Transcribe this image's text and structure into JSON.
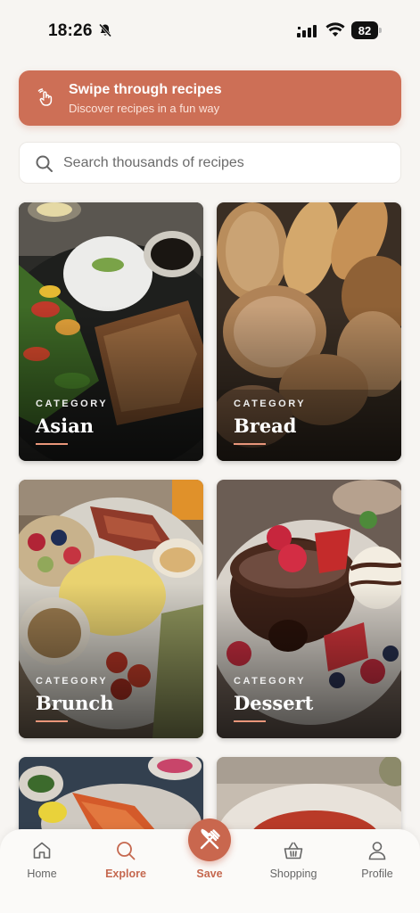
{
  "status_bar": {
    "time": "18:26",
    "battery": "82",
    "icons": [
      "bell-slash-icon",
      "signal-icon",
      "wifi-icon",
      "battery-icon"
    ]
  },
  "banner": {
    "title": "Swipe through recipes",
    "subtitle": "Discover recipes in a fun way",
    "icon": "swipe-hand-icon",
    "color": "#cd6f56"
  },
  "search": {
    "placeholder": "Search thousands of recipes",
    "value": ""
  },
  "categories": [
    {
      "label": "CATEGORY",
      "name": "Asian"
    },
    {
      "label": "CATEGORY",
      "name": "Bread"
    },
    {
      "label": "CATEGORY",
      "name": "Brunch"
    },
    {
      "label": "CATEGORY",
      "name": "Dessert"
    }
  ],
  "nav": {
    "items": [
      {
        "label": "Home",
        "icon": "home-icon"
      },
      {
        "label": "Explore",
        "icon": "search-icon"
      },
      {
        "label": "Save",
        "icon": "fork-knife-icon"
      },
      {
        "label": "Shopping",
        "icon": "basket-icon"
      },
      {
        "label": "Profile",
        "icon": "user-icon"
      }
    ],
    "active": "Explore",
    "accent": "#c5684f"
  }
}
